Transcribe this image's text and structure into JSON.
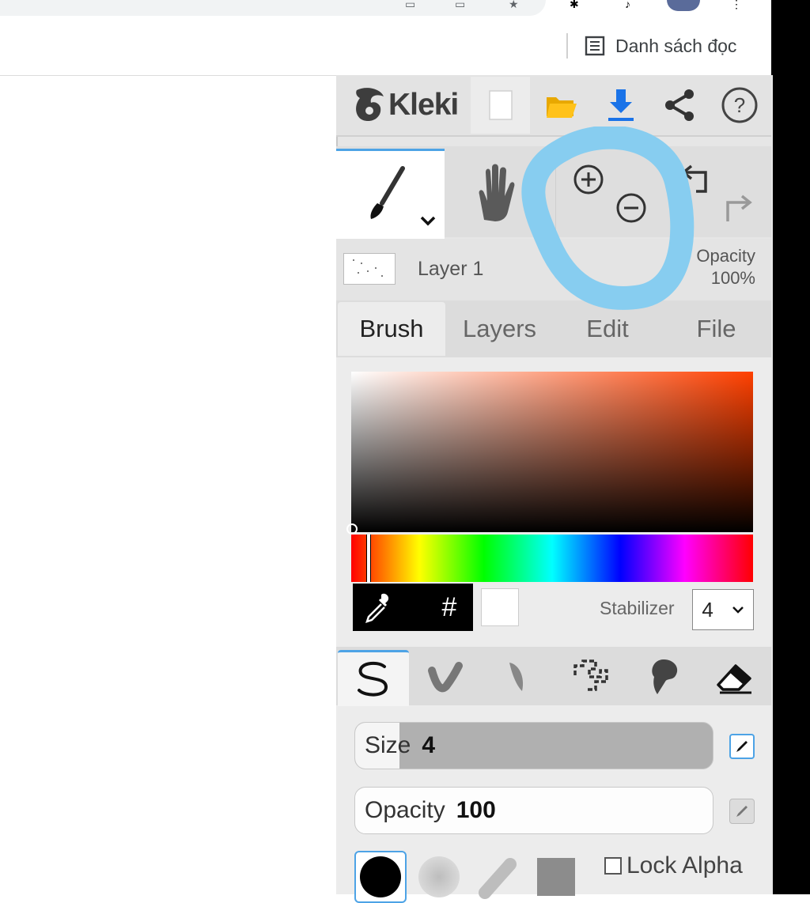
{
  "browser": {
    "reading_list_label": "Danh sách đọc"
  },
  "app": {
    "logo_text": "Kleki",
    "accent_color": "#4da3e6"
  },
  "toolbar": {
    "icons": [
      "new-image-icon",
      "open-folder-icon",
      "download-icon",
      "share-icon",
      "help-icon"
    ]
  },
  "tools": {
    "icons": [
      "brush-tool-icon",
      "hand-tool-icon",
      "zoom-in-icon",
      "zoom-out-icon",
      "undo-icon",
      "redo-icon"
    ]
  },
  "layer": {
    "name": "Layer 1",
    "opacity_label": "Opacity",
    "opacity_value": "100%"
  },
  "tabs": [
    {
      "label": "Brush",
      "active": true
    },
    {
      "label": "Layers",
      "active": false
    },
    {
      "label": "Edit",
      "active": false
    },
    {
      "label": "File",
      "active": false
    }
  ],
  "color": {
    "hue_color": "#ff4000",
    "current_color": "#ffffff",
    "hex_button": "#"
  },
  "stabilizer": {
    "label": "Stabilizer",
    "value": "4"
  },
  "brush_types": [
    "pen-brush-icon",
    "blend-brush-icon",
    "sketchy-brush-icon",
    "pixel-brush-icon",
    "chemy-brush-icon",
    "eraser-icon"
  ],
  "size": {
    "label": "Size",
    "value": "4"
  },
  "opacity": {
    "label": "Opacity",
    "value": "100"
  },
  "lock_alpha": {
    "label": "Lock Alpha",
    "checked": false
  }
}
